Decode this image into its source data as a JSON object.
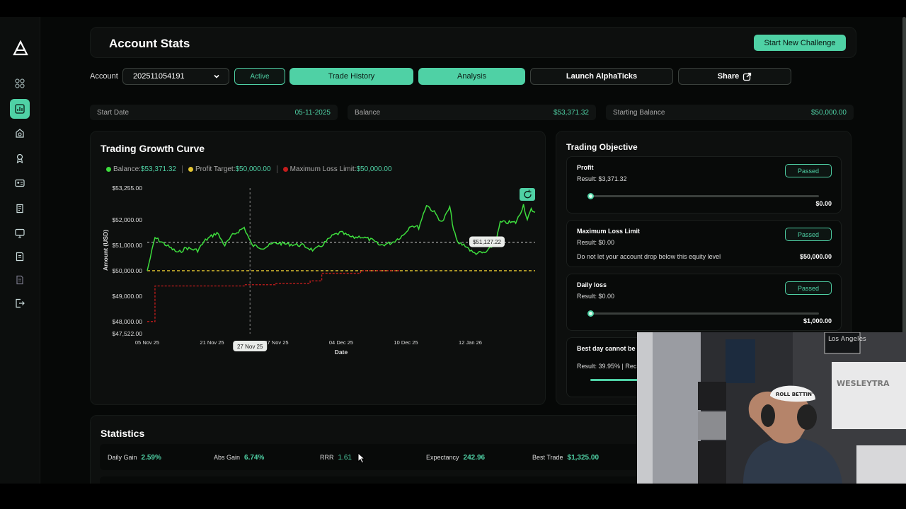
{
  "header": {
    "title": "Account Stats",
    "new_challenge": "Start New Challenge"
  },
  "controls": {
    "account_label": "Account",
    "account_id": "202511054191",
    "status": "Active",
    "trade_history": "Trade History",
    "analysis": "Analysis",
    "launch": "Launch AlphaTicks",
    "share": "Share"
  },
  "info": {
    "start_date_label": "Start Date",
    "start_date": "05-11-2025",
    "balance_label": "Balance",
    "balance": "$53,371.32",
    "starting_balance_label": "Starting Balance",
    "starting_balance": "$50,000.00"
  },
  "growth": {
    "title": "Trading Growth Curve",
    "legend_balance": "Balance:",
    "legend_balance_val": "$53,371.32",
    "legend_target": "Profit Target:",
    "legend_target_val": "$50,000.00",
    "legend_loss": "Maximum Loss Limit:",
    "legend_loss_val": "$50,000.00"
  },
  "chart_data": {
    "type": "line",
    "xlabel": "Date",
    "ylabel": "Amount (USD)",
    "y_ticks": [
      "$53,255.00",
      "$52,000.00",
      "$51,000.00",
      "$50,000.00",
      "$49,000.00",
      "$48,000.00",
      "$47,522.00"
    ],
    "y_tick_values": [
      53255,
      52000,
      51000,
      50000,
      49000,
      48000,
      47522
    ],
    "ylim": [
      47522,
      53255
    ],
    "x_ticks": [
      "05 Nov 25",
      "21 Nov 25",
      "27 Nov 25",
      "04 Dec 25",
      "10 Dec 25",
      "12 Jan 26"
    ],
    "x_tick_positions": [
      0,
      0.167,
      0.333,
      0.5,
      0.667,
      0.833
    ],
    "series": [
      {
        "name": "Balance",
        "color": "#3ddc3d",
        "x": [
          0,
          0.02,
          0.05,
          0.08,
          0.1,
          0.13,
          0.15,
          0.18,
          0.2,
          0.22,
          0.25,
          0.27,
          0.3,
          0.33,
          0.36,
          0.4,
          0.43,
          0.45,
          0.48,
          0.5,
          0.53,
          0.55,
          0.58,
          0.6,
          0.63,
          0.66,
          0.68,
          0.7,
          0.72,
          0.74,
          0.76,
          0.78,
          0.79,
          0.8,
          0.82,
          0.84,
          0.86,
          0.87,
          0.88,
          0.9,
          0.91,
          0.93,
          0.94,
          0.95,
          0.96,
          0.97,
          0.98,
          0.99,
          1.0
        ],
        "y": [
          50000,
          51300,
          51000,
          50700,
          50900,
          50800,
          51200,
          51500,
          51000,
          51400,
          51700,
          51000,
          50900,
          51100,
          51050,
          51000,
          50800,
          51000,
          51400,
          51500,
          51300,
          51350,
          51200,
          51000,
          51100,
          51400,
          51800,
          51700,
          52600,
          52300,
          51900,
          52500,
          51600,
          51100,
          51000,
          50700,
          50700,
          50700,
          50800,
          51200,
          51900,
          51900,
          51900,
          51900,
          52200,
          52600,
          52000,
          52400,
          52300
        ]
      },
      {
        "name": "Profit Target",
        "color": "#e3c532",
        "x": [
          0,
          1
        ],
        "y": [
          50000,
          50000
        ]
      },
      {
        "name": "Maximum Loss Limit",
        "color": "#c41d1d",
        "x": [
          0,
          0.02,
          0.05,
          0.2,
          0.25,
          0.33,
          0.4,
          0.42,
          0.45,
          0.55,
          0.6,
          0.65
        ],
        "y": [
          48000,
          49400,
          49400,
          49400,
          49450,
          49500,
          49500,
          49600,
          49900,
          50000,
          50000,
          50000
        ]
      }
    ],
    "reference_line": 51127.22,
    "tooltip_value": "$51,127.22",
    "hover_date": "27 Nov 25"
  },
  "objectives": {
    "title": "Trading Objective",
    "items": [
      {
        "name": "Profit",
        "result": "Result: $3,371.32",
        "status": "Passed",
        "value": "$0.00"
      },
      {
        "name": "Maximum Loss Limit",
        "result": "Result: $0.00",
        "status": "Passed",
        "desc": "Do not let your account drop below this equity level",
        "value": "$50,000.00"
      },
      {
        "name": "Daily loss",
        "result": "Result: $0.00",
        "status": "Passed",
        "value": "$1,000.00"
      },
      {
        "name": "Best day cannot be gr",
        "result": "Result: 39.95%   |   Rec"
      }
    ]
  },
  "statistics": {
    "title": "Statistics",
    "items": [
      {
        "label": "Daily Gain",
        "value": "2.59%"
      },
      {
        "label": "Abs Gain",
        "value": "6.74%"
      },
      {
        "label": "RRR",
        "value": "1.61"
      },
      {
        "label": "Expectancy",
        "value": "242.96"
      },
      {
        "label": "Best Trade",
        "value": "$1,325.00"
      }
    ]
  },
  "webcam": {
    "cap_text": "ROLL BETTIN'",
    "sign_text": "Los Angeles",
    "screen_text": "WESLEYTRA"
  },
  "colors": {
    "accent": "#4fd1a5",
    "background": "#060807",
    "card": "#0d0f0e"
  }
}
